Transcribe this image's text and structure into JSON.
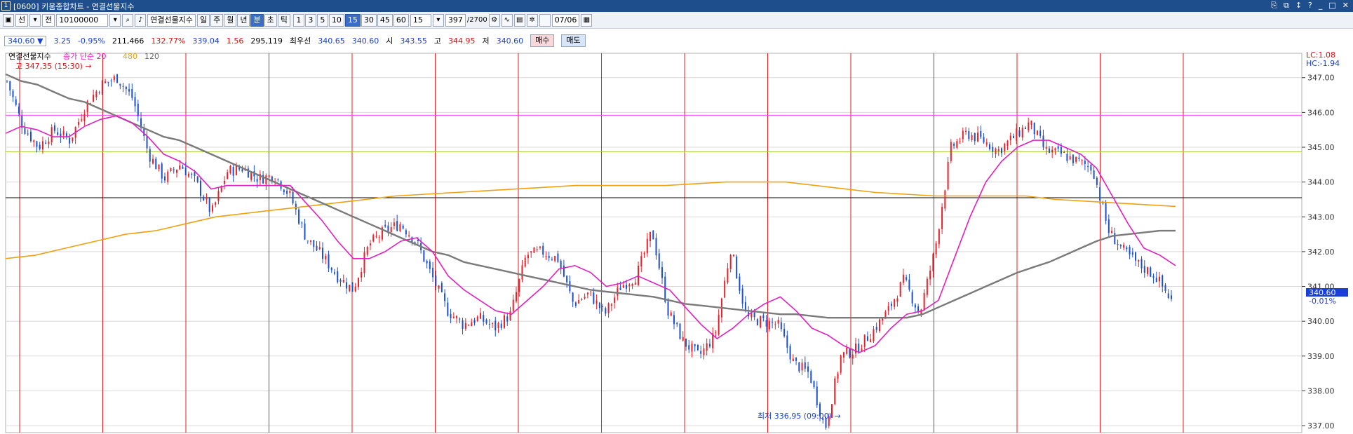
{
  "window": {
    "number": "1",
    "title": "[0600] 키움종합차트 - 연결선물지수",
    "controls": [
      "⎘",
      "⧉",
      "↕",
      "?",
      "_",
      "□",
      "✕"
    ]
  },
  "toolbar": {
    "b1": "선",
    "b2": "전",
    "code": "10100000",
    "name": "연결선물지수",
    "periods": [
      "일",
      "주",
      "월",
      "년",
      "분",
      "초",
      "틱"
    ],
    "active_period": "분",
    "mins": [
      "1",
      "3",
      "5",
      "10",
      "15",
      "30",
      "45",
      "60"
    ],
    "active_min": "15",
    "interval": "15",
    "count": "397",
    "total": "/2700",
    "date": "07/06"
  },
  "quote": {
    "price": "340.60 ▼",
    "change": "3.25",
    "pct": "-0.95%",
    "volume": "211,466",
    "vol_pct": "132.77%",
    "v2": "339.04",
    "v3": "1.56",
    "v4": "295,119",
    "open_label": "최우선",
    "bid": "340.65",
    "ask": "340.60",
    "o_label": "시",
    "o": "343.55",
    "h_label": "고",
    "h": "344.95",
    "l_label": "저",
    "l": "340.60",
    "buy": "매수",
    "sell": "매도"
  },
  "legend": {
    "name": "연결선물지수",
    "ma_label": "종가 단순 20",
    "ma2": "480",
    "ma3": "120"
  },
  "annotations": {
    "high": "고 347,35 (15:30) →",
    "low": "최저 336,95 (09:00) →"
  },
  "right_labels": {
    "lc": "LC:1.08",
    "hc": "HC:-1.94",
    "price_tag": "340.60",
    "price_pct": "-0.01%"
  },
  "colors": {
    "up": "#e8202a",
    "down": "#1d4fd0",
    "ma20": "#e020c0",
    "ma120": "#7a7a7a",
    "ma480": "#f0a010",
    "vline": "#e02020",
    "hline_magenta": "#ff40ff",
    "hline_green": "#a8d040",
    "hline_black": "#000000",
    "title_bg": "#1f4e8c"
  },
  "chart_data": {
    "type": "candlestick",
    "ylim": [
      336.8,
      347.7
    ],
    "yticks": [
      "347.00",
      "346.00",
      "345.00",
      "344.00",
      "343.00",
      "342.00",
      "341.00",
      "340.00",
      "339.00",
      "338.00",
      "337.00"
    ],
    "hlines": [
      345.92,
      344.87,
      343.55
    ],
    "close_path": [
      346.9,
      345.6,
      345.0,
      345.5,
      345.2,
      346.2,
      346.8,
      347.0,
      346.4,
      344.8,
      344.1,
      344.5,
      344.0,
      343.1,
      344.3,
      344.4,
      344.1,
      344.2,
      343.6,
      342.4,
      341.9,
      341.3,
      340.9,
      342.2,
      342.6,
      342.8,
      342.3,
      341.3,
      340.3,
      339.9,
      340.1,
      339.8,
      340.2,
      341.9,
      342.0,
      341.8,
      340.5,
      340.8,
      340.2,
      341.0,
      341.3,
      342.6,
      340.3,
      339.4,
      339.0,
      339.6,
      342.1,
      340.1,
      340.0,
      339.9,
      338.8,
      338.5,
      336.9,
      339.0,
      339.2,
      339.7,
      340.3,
      341.2,
      340.2,
      342.1,
      345.0,
      345.4,
      345.2,
      344.9,
      345.3,
      345.7,
      344.9,
      344.8,
      344.6,
      344.4,
      342.6,
      342.0,
      341.6,
      341.3,
      340.6
    ],
    "ma20": [
      345.4,
      345.6,
      345.5,
      345.3,
      345.3,
      345.6,
      345.8,
      345.9,
      345.7,
      345.3,
      344.8,
      344.6,
      344.3,
      343.8,
      343.9,
      343.9,
      343.9,
      343.9,
      343.9,
      343.4,
      342.9,
      342.3,
      341.8,
      341.8,
      342.0,
      342.3,
      342.4,
      342.0,
      341.3,
      340.9,
      340.6,
      340.3,
      340.2,
      340.6,
      341.0,
      341.5,
      341.6,
      341.4,
      341.0,
      341.1,
      341.3,
      341.1,
      340.9,
      340.4,
      339.9,
      339.5,
      339.8,
      340.2,
      340.5,
      340.7,
      340.3,
      339.8,
      339.6,
      339.3,
      339.1,
      339.3,
      339.8,
      340.2,
      340.3,
      340.6,
      341.8,
      343.0,
      344.0,
      344.6,
      345.0,
      345.2,
      345.2,
      345.0,
      344.8,
      344.4,
      343.6,
      342.8,
      342.1,
      341.9,
      341.6
    ],
    "ma120": [
      347.1,
      346.9,
      346.8,
      346.6,
      346.4,
      346.3,
      346.1,
      345.9,
      345.7,
      345.5,
      345.3,
      345.2,
      345.0,
      344.8,
      344.6,
      344.4,
      344.2,
      344.0,
      343.8,
      343.6,
      343.4,
      343.2,
      343.0,
      342.8,
      342.6,
      342.4,
      342.2,
      342.0,
      341.9,
      341.7,
      341.6,
      341.5,
      341.4,
      341.3,
      341.2,
      341.1,
      341.0,
      340.9,
      340.85,
      340.8,
      340.75,
      340.7,
      340.6,
      340.5,
      340.45,
      340.4,
      340.35,
      340.3,
      340.25,
      340.2,
      340.2,
      340.15,
      340.1,
      340.1,
      340.1,
      340.1,
      340.1,
      340.1,
      340.2,
      340.4,
      340.6,
      340.8,
      341.0,
      341.2,
      341.4,
      341.55,
      341.7,
      341.9,
      342.1,
      342.3,
      342.45,
      342.5,
      342.55,
      342.6,
      342.6
    ],
    "ma480": [
      341.8,
      341.9,
      342.1,
      342.3,
      342.5,
      342.6,
      342.8,
      343.0,
      343.1,
      343.2,
      343.3,
      343.4,
      343.5,
      343.6,
      343.65,
      343.7,
      343.75,
      343.8,
      343.85,
      343.9,
      343.9,
      343.9,
      343.9,
      343.95,
      344.0,
      344.0,
      344.0,
      343.9,
      343.8,
      343.7,
      343.65,
      343.6,
      343.6,
      343.6,
      343.6,
      343.5,
      343.45,
      343.4,
      343.35,
      343.3
    ]
  }
}
